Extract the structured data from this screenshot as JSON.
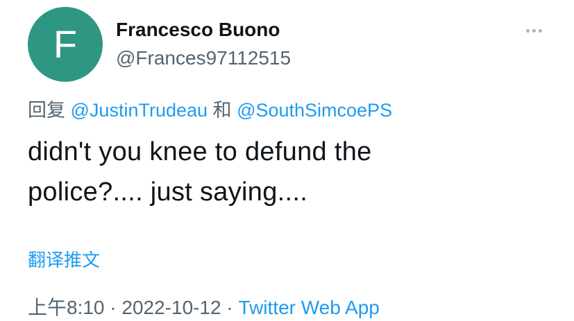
{
  "author": {
    "avatar_letter": "F",
    "avatar_color": "#2e9683",
    "display_name": "Francesco Buono",
    "handle": "@Frances97112515"
  },
  "reply": {
    "prefix": "回复",
    "mention_1": "@JustinTrudeau",
    "conjunction": "和",
    "mention_2": "@SouthSimcoePS"
  },
  "tweet": {
    "text_line_1": "didn't you knee to defund the",
    "text_line_2": "police?.... just saying...."
  },
  "translate_label": "翻译推文",
  "meta": {
    "time": "上午8:10",
    "separator_1": " · ",
    "date": "2022-10-12",
    "separator_2": " · ",
    "source": "Twitter Web App"
  },
  "icons": {
    "more": "more-horizontal-icon"
  },
  "colors": {
    "link": "#1d9bf0",
    "text": "#0f1419",
    "secondary": "#536471"
  }
}
